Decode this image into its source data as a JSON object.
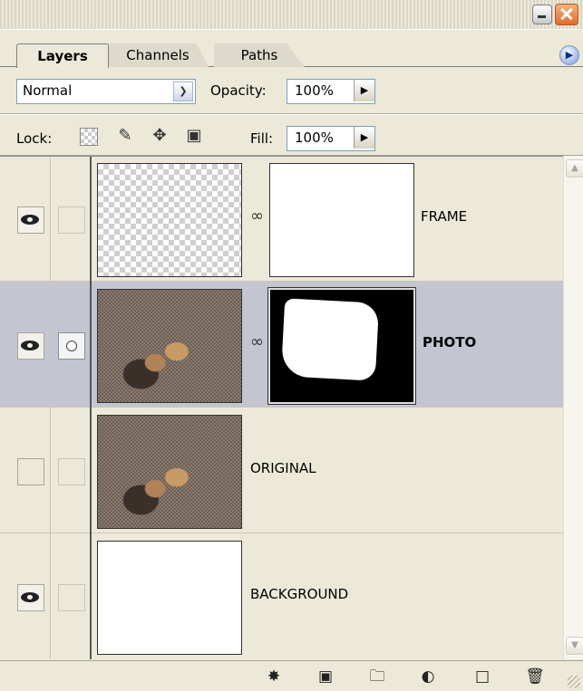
{
  "panel": {
    "tabs": [
      {
        "label": "Layers",
        "active": true
      },
      {
        "label": "Channels",
        "active": false
      },
      {
        "label": "Paths",
        "active": false
      }
    ],
    "menu_icon": "panel-menu-arrow-icon",
    "blend_mode": "Normal",
    "opacity_label": "Opacity:",
    "opacity_value": "100%",
    "lock_label": "Lock:",
    "fill_label": "Fill:",
    "fill_value": "100%"
  },
  "layers": [
    {
      "name": "FRAME",
      "visible": true,
      "selected": false,
      "has_mask": true,
      "thumbnail": "transparent"
    },
    {
      "name": "PHOTO",
      "visible": true,
      "selected": true,
      "has_mask": true,
      "thumbnail": "photo"
    },
    {
      "name": "ORIGINAL",
      "visible": false,
      "selected": false,
      "has_mask": false,
      "thumbnail": "photo"
    },
    {
      "name": "BACKGROUND",
      "visible": true,
      "selected": false,
      "has_mask": false,
      "thumbnail": "white"
    }
  ],
  "bottom_icons": [
    "layer-style-icon",
    "add-mask-icon",
    "new-group-icon",
    "adjustment-layer-icon",
    "new-layer-icon",
    "trash-icon"
  ],
  "colors": {
    "panel_bg": "#ece9d8",
    "selected_row": "#c3c6d1"
  }
}
